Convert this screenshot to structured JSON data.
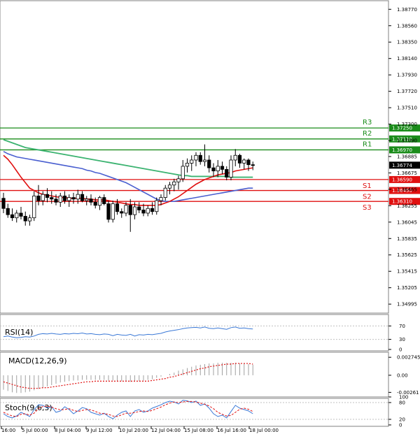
{
  "chart_data": {
    "type": "candlestick",
    "main": {
      "y_ticks": [
        "1.38770",
        "1.38560",
        "1.38350",
        "1.38140",
        "1.37930",
        "1.37720",
        "1.37510",
        "1.37300",
        "1.37090",
        "1.36885",
        "1.36675",
        "1.36465",
        "1.36255",
        "1.36045",
        "1.35835",
        "1.35625",
        "1.35415",
        "1.35205",
        "1.34995"
      ],
      "ylim": [
        1.3488,
        1.3888
      ],
      "x_ticks": [
        "16:00",
        "5 Jul 00:00",
        "8 Jul 04:00",
        "9 Jul 12:00",
        "10 Jul 20:00",
        "12 Jul 04:00",
        "15 Jul 08:00",
        "16 Jul 16:00",
        "18 Jul 00:00"
      ],
      "current_price": "1.36774",
      "levels": [
        {
          "name": "R3",
          "value": 1.3725,
          "label": "1.37250",
          "color": "#1a8c1a"
        },
        {
          "name": "R2",
          "value": 1.3711,
          "label": "1.37110",
          "color": "#1a8c1a"
        },
        {
          "name": "R1",
          "value": 1.3697,
          "label": "1.36970",
          "color": "#1a8c1a"
        },
        {
          "name": "S1",
          "value": 1.3659,
          "label": "1.36590",
          "color": "#e01010"
        },
        {
          "name": "S2",
          "value": 1.3645,
          "label": "1.36450",
          "color": "#e01010"
        },
        {
          "name": "S3",
          "value": 1.3631,
          "label": "1.36310",
          "color": "#e01010"
        }
      ],
      "candles": [
        [
          1.3635,
          1.3642,
          1.3616,
          1.3622
        ],
        [
          1.3622,
          1.3628,
          1.361,
          1.3614
        ],
        [
          1.3614,
          1.3622,
          1.3606,
          1.361
        ],
        [
          1.361,
          1.362,
          1.3604,
          1.3616
        ],
        [
          1.3616,
          1.3624,
          1.3608,
          1.3612
        ],
        [
          1.3612,
          1.3618,
          1.36,
          1.3606
        ],
        [
          1.3606,
          1.3614,
          1.36,
          1.361
        ],
        [
          1.361,
          1.3644,
          1.3606,
          1.3638
        ],
        [
          1.3638,
          1.3652,
          1.3626,
          1.3632
        ],
        [
          1.3632,
          1.3644,
          1.3626,
          1.364
        ],
        [
          1.364,
          1.3648,
          1.363,
          1.3636
        ],
        [
          1.3636,
          1.3644,
          1.3628,
          1.3634
        ],
        [
          1.3634,
          1.364,
          1.3626,
          1.363
        ],
        [
          1.363,
          1.3642,
          1.3624,
          1.3638
        ],
        [
          1.3638,
          1.3644,
          1.3628,
          1.3632
        ],
        [
          1.3632,
          1.364,
          1.3624,
          1.3636
        ],
        [
          1.3636,
          1.3642,
          1.3628,
          1.3634
        ],
        [
          1.3634,
          1.3646,
          1.3628,
          1.364
        ],
        [
          1.364,
          1.3644,
          1.363,
          1.3632
        ],
        [
          1.3632,
          1.3638,
          1.3626,
          1.3634
        ],
        [
          1.3634,
          1.364,
          1.3626,
          1.363
        ],
        [
          1.363,
          1.3636,
          1.3622,
          1.3626
        ],
        [
          1.3626,
          1.3638,
          1.362,
          1.3636
        ],
        [
          1.3636,
          1.364,
          1.3626,
          1.3628
        ],
        [
          1.3628,
          1.3632,
          1.3604,
          1.3608
        ],
        [
          1.3608,
          1.3632,
          1.3604,
          1.3628
        ],
        [
          1.3628,
          1.3634,
          1.3614,
          1.3618
        ],
        [
          1.3618,
          1.3622,
          1.361,
          1.3616
        ],
        [
          1.3616,
          1.363,
          1.3612,
          1.3626
        ],
        [
          1.3626,
          1.3634,
          1.3592,
          1.3614
        ],
        [
          1.3614,
          1.363,
          1.3608,
          1.3624
        ],
        [
          1.3624,
          1.363,
          1.3616,
          1.362
        ],
        [
          1.362,
          1.3628,
          1.3612,
          1.3616
        ],
        [
          1.3616,
          1.3626,
          1.3612,
          1.3622
        ],
        [
          1.3622,
          1.363,
          1.3614,
          1.3618
        ],
        [
          1.3618,
          1.3636,
          1.3614,
          1.3632
        ],
        [
          1.3632,
          1.364,
          1.3626,
          1.3636
        ],
        [
          1.3636,
          1.3652,
          1.3632,
          1.3648
        ],
        [
          1.3648,
          1.3656,
          1.364,
          1.3652
        ],
        [
          1.3652,
          1.366,
          1.3644,
          1.3656
        ],
        [
          1.3656,
          1.3664,
          1.3646,
          1.366
        ],
        [
          1.366,
          1.3684,
          1.3656,
          1.3676
        ],
        [
          1.3676,
          1.3686,
          1.3668,
          1.368
        ],
        [
          1.368,
          1.369,
          1.367,
          1.3684
        ],
        [
          1.3684,
          1.3694,
          1.3676,
          1.369
        ],
        [
          1.369,
          1.3694,
          1.3678,
          1.3682
        ],
        [
          1.3682,
          1.3704,
          1.3676,
          1.3684
        ],
        [
          1.3684,
          1.369,
          1.3668,
          1.3674
        ],
        [
          1.3674,
          1.368,
          1.3662,
          1.367
        ],
        [
          1.367,
          1.3684,
          1.3662,
          1.3676
        ],
        [
          1.3676,
          1.3682,
          1.3666,
          1.3672
        ],
        [
          1.3672,
          1.3676,
          1.3658,
          1.3662
        ],
        [
          1.3662,
          1.369,
          1.3658,
          1.3684
        ],
        [
          1.3684,
          1.3698,
          1.3676,
          1.369
        ],
        [
          1.369,
          1.3692,
          1.3674,
          1.368
        ],
        [
          1.368,
          1.3686,
          1.3672,
          1.3684
        ],
        [
          1.3684,
          1.3686,
          1.367,
          1.3678
        ],
        [
          1.3678,
          1.3682,
          1.3671,
          1.3677
        ]
      ],
      "ma_red": [
        1.369,
        1.3685,
        1.3678,
        1.367,
        1.3662,
        1.3655,
        1.3648,
        1.3645,
        1.3642,
        1.364,
        1.3639,
        1.3638,
        1.3637,
        1.3636,
        1.3636,
        1.3635,
        1.3635,
        1.3635,
        1.3635,
        1.3634,
        1.3634,
        1.3633,
        1.3633,
        1.3633,
        1.3632,
        1.3631,
        1.363,
        1.3629,
        1.3628,
        1.3627,
        1.3627,
        1.3626,
        1.3626,
        1.3626,
        1.3626,
        1.3626,
        1.3627,
        1.3629,
        1.3631,
        1.3634,
        1.3637,
        1.3641,
        1.3645,
        1.3649,
        1.3653,
        1.3656,
        1.3659,
        1.3661,
        1.3663,
        1.3665,
        1.3666,
        1.3667,
        1.3668,
        1.367,
        1.3671,
        1.3672,
        1.3673,
        1.3674
      ],
      "ma_blue": [
        1.3695,
        1.3692,
        1.369,
        1.3688,
        1.3687,
        1.3686,
        1.3685,
        1.3684,
        1.3683,
        1.3682,
        1.3681,
        1.368,
        1.3679,
        1.3678,
        1.3677,
        1.3676,
        1.3675,
        1.3674,
        1.3673,
        1.3671,
        1.367,
        1.3668,
        1.3667,
        1.3665,
        1.3663,
        1.3661,
        1.3659,
        1.3657,
        1.3655,
        1.3652,
        1.3649,
        1.3646,
        1.3643,
        1.364,
        1.3637,
        1.3634,
        1.3632,
        1.3631,
        1.3631,
        1.3631,
        1.3632,
        1.3633,
        1.3634,
        1.3635,
        1.3636,
        1.3637,
        1.3638,
        1.3639,
        1.364,
        1.3641,
        1.3642,
        1.3643,
        1.3644,
        1.3645,
        1.3646,
        1.3647,
        1.3648,
        1.3648
      ],
      "ma_green": [
        1.371,
        1.3708,
        1.3706,
        1.3704,
        1.3702,
        1.37,
        1.3699,
        1.3698,
        1.3697,
        1.3696,
        1.3695,
        1.3694,
        1.3693,
        1.3692,
        1.3691,
        1.369,
        1.3689,
        1.3688,
        1.3687,
        1.3686,
        1.3685,
        1.3684,
        1.3683,
        1.3682,
        1.3681,
        1.368,
        1.3679,
        1.3678,
        1.3677,
        1.3676,
        1.3675,
        1.3674,
        1.3673,
        1.3672,
        1.3671,
        1.367,
        1.3669,
        1.3668,
        1.3667,
        1.3666,
        1.3665,
        1.3664,
        1.3664,
        1.3663,
        1.3663,
        1.3663,
        1.3663,
        1.3663,
        1.3663,
        1.3663,
        1.3663,
        1.3663,
        1.3662,
        1.3662,
        1.3662,
        1.3662,
        1.3662,
        1.3662
      ]
    },
    "rsi": {
      "title": "RSI(14)",
      "y_ticks": [
        "70",
        "30",
        "0"
      ],
      "ylim": [
        0,
        100
      ],
      "values": [
        38,
        40,
        37,
        35,
        36,
        38,
        37,
        40,
        45,
        47,
        46,
        48,
        46,
        45,
        47,
        46,
        48,
        47,
        49,
        46,
        47,
        45,
        44,
        46,
        45,
        41,
        45,
        43,
        42,
        45,
        40,
        44,
        43,
        45,
        44,
        46,
        48,
        52,
        55,
        57,
        59,
        62,
        64,
        65,
        66,
        64,
        67,
        63,
        62,
        64,
        62,
        60,
        65,
        67,
        63,
        64,
        62,
        61
      ]
    },
    "macd": {
      "title": "MACD(12,26,9)",
      "y_ticks": [
        "0.002745",
        "0.00",
        "-0.00261"
      ],
      "ylim": [
        -0.0031,
        0.0033
      ],
      "histogram": [
        -0.0022,
        -0.0024,
        -0.0026,
        -0.0027,
        -0.0027,
        -0.0026,
        -0.0025,
        -0.0023,
        -0.0021,
        -0.0019,
        -0.0017,
        -0.0015,
        -0.0013,
        -0.0011,
        -0.001,
        -0.0009,
        -0.0008,
        -0.0008,
        -0.0007,
        -0.0007,
        -0.0007,
        -0.0007,
        -0.0007,
        -0.0007,
        -0.0008,
        -0.0008,
        -0.0009,
        -0.0009,
        -0.0009,
        -0.001,
        -0.0009,
        -0.0009,
        -0.0008,
        -0.0007,
        -0.0006,
        -0.0004,
        -0.0002,
        0.0,
        0.0002,
        0.0004,
        0.0007,
        0.0009,
        0.0011,
        0.0013,
        0.0015,
        0.0016,
        0.0017,
        0.0018,
        0.0018,
        0.0019,
        0.0019,
        0.0019,
        0.0019,
        0.0019,
        0.0018,
        0.0018,
        0.0017,
        0.0016
      ],
      "signal": [
        -0.001,
        -0.0012,
        -0.0014,
        -0.0016,
        -0.0018,
        -0.0019,
        -0.002,
        -0.002,
        -0.002,
        -0.0019,
        -0.0019,
        -0.0018,
        -0.0017,
        -0.0016,
        -0.0015,
        -0.0014,
        -0.0013,
        -0.0012,
        -0.0011,
        -0.001,
        -0.001,
        -0.0009,
        -0.0009,
        -0.0009,
        -0.0009,
        -0.0009,
        -0.0009,
        -0.0009,
        -0.0009,
        -0.0009,
        -0.0009,
        -0.0009,
        -0.0009,
        -0.0009,
        -0.0008,
        -0.0007,
        -0.0006,
        -0.0005,
        -0.0003,
        -0.0002,
        0.0,
        0.0002,
        0.0004,
        0.0006,
        0.0008,
        0.001,
        0.0011,
        0.0013,
        0.0014,
        0.0015,
        0.0016,
        0.0017,
        0.0017,
        0.0018,
        0.0018,
        0.0018,
        0.0018,
        0.0017
      ]
    },
    "stoch": {
      "title": "Stoch(9,6,3)",
      "y_ticks": [
        "100",
        "80",
        "20",
        "0"
      ],
      "ylim": [
        0,
        100
      ],
      "k": [
        40,
        30,
        25,
        32,
        45,
        38,
        30,
        55,
        72,
        70,
        60,
        65,
        45,
        50,
        65,
        55,
        40,
        50,
        62,
        58,
        45,
        40,
        35,
        42,
        30,
        22,
        35,
        45,
        50,
        30,
        50,
        55,
        45,
        50,
        60,
        66,
        72,
        80,
        85,
        82,
        75,
        88,
        86,
        80,
        85,
        70,
        75,
        60,
        40,
        30,
        35,
        25,
        48,
        70,
        60,
        55,
        50,
        40
      ],
      "d": [
        45,
        38,
        32,
        30,
        38,
        40,
        35,
        42,
        58,
        66,
        67,
        64,
        58,
        54,
        55,
        58,
        52,
        48,
        52,
        55,
        54,
        48,
        42,
        40,
        38,
        32,
        30,
        36,
        42,
        42,
        44,
        48,
        50,
        48,
        52,
        58,
        64,
        72,
        78,
        82,
        80,
        82,
        84,
        84,
        82,
        78,
        74,
        68,
        58,
        45,
        38,
        32,
        34,
        45,
        56,
        60,
        56,
        48
      ]
    }
  }
}
